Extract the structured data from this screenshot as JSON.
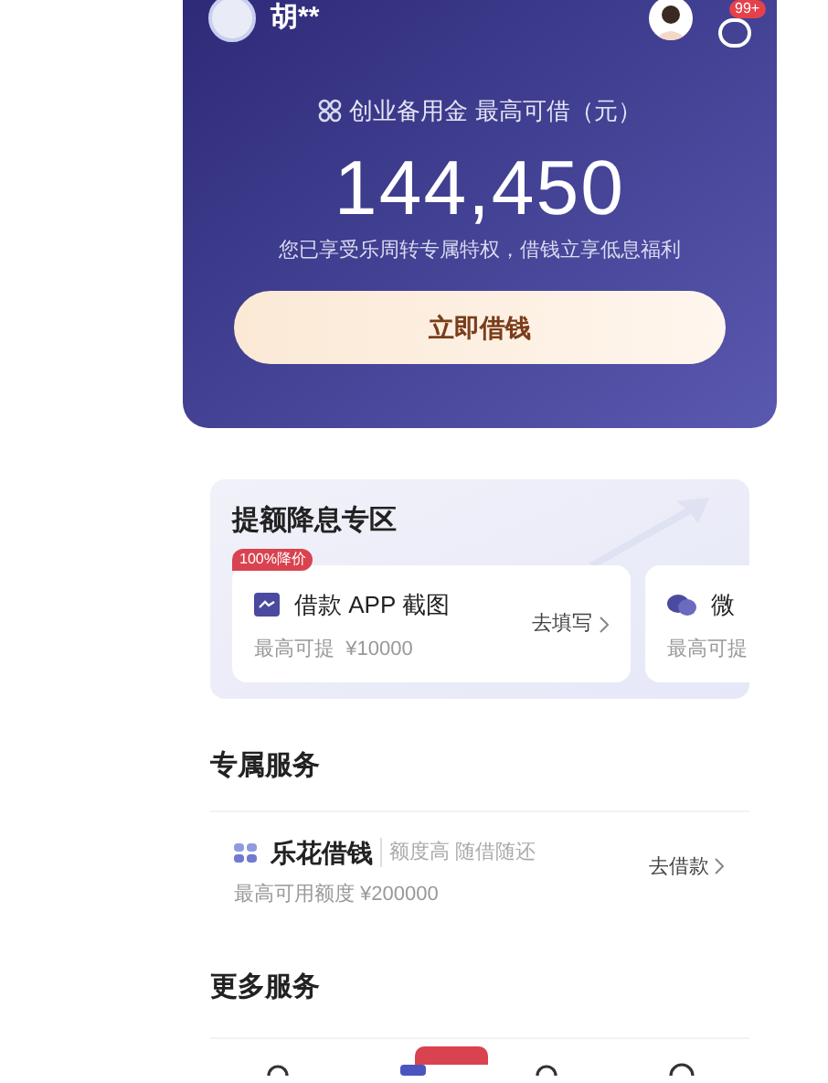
{
  "header": {
    "user_name": "胡**",
    "message_badge": "99+"
  },
  "credit": {
    "label": "创业备用金 最高可借（元）",
    "amount": "144,450",
    "note": "您已享受乐周转专属特权，借钱立享低息福利",
    "button": "立即借钱"
  },
  "boost_section": {
    "title": "提额降息专区",
    "badge": "100%降价",
    "cards": [
      {
        "title": "借款 APP 截图",
        "subtitle": "最高可提  ¥10000",
        "action": "去填写"
      },
      {
        "title": "微",
        "subtitle": "最高可提"
      }
    ]
  },
  "exclusive_services": {
    "title": "专属服务",
    "items": [
      {
        "name": "乐花借钱",
        "tagline": "额度高 随借随还",
        "limit": "最高可用额度 ¥200000",
        "action": "去借款"
      }
    ]
  },
  "more_services": {
    "title": "更多服务"
  }
}
